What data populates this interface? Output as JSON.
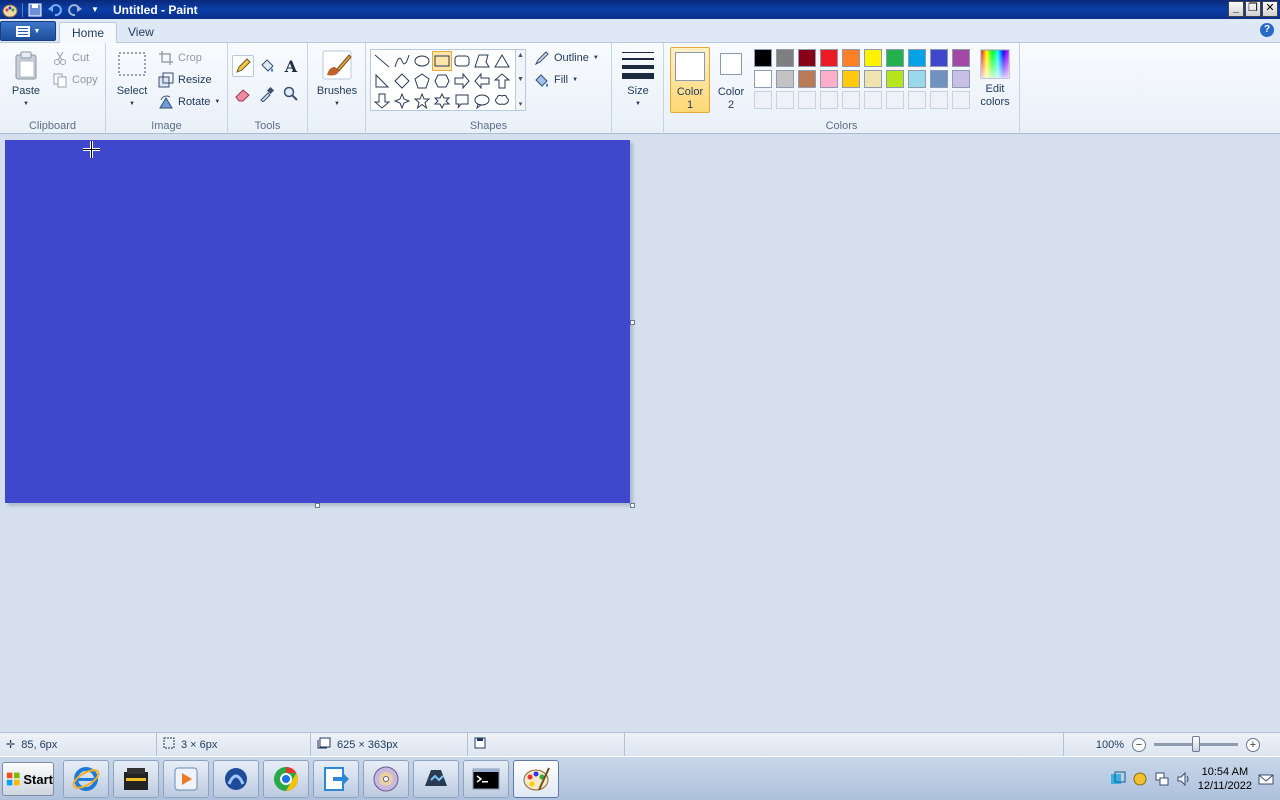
{
  "window": {
    "title": "Untitled - Paint"
  },
  "tabs": [
    {
      "label": "Home"
    },
    {
      "label": "View"
    }
  ],
  "ribbon": {
    "clipboard": {
      "label": "Clipboard",
      "paste": "Paste",
      "cut": "Cut",
      "copy": "Copy"
    },
    "image": {
      "label": "Image",
      "select": "Select",
      "crop": "Crop",
      "resize": "Resize",
      "rotate": "Rotate"
    },
    "tools": {
      "label": "Tools"
    },
    "brushes": {
      "label": "Brushes"
    },
    "shapes": {
      "label": "Shapes",
      "outline": "Outline",
      "fill": "Fill"
    },
    "size": {
      "label": "Size"
    },
    "colors": {
      "label": "Colors",
      "color1": "Color\n1",
      "color1_a": "Color",
      "color1_b": "1",
      "color2_a": "Color",
      "color2_b": "2",
      "edit_a": "Edit",
      "edit_b": "colors",
      "row1": [
        "#000000",
        "#7f7f7f",
        "#880015",
        "#ed1c24",
        "#ff7f27",
        "#fff200",
        "#22b14c",
        "#00a2e8",
        "#3f48cc",
        "#a349a4"
      ],
      "row2": [
        "#ffffff",
        "#c3c3c3",
        "#b97a57",
        "#ffaec9",
        "#ffc90e",
        "#efe4b0",
        "#b5e61d",
        "#99d9ea",
        "#7092be",
        "#c8bfe7"
      ]
    }
  },
  "canvas": {
    "color": "#3f48cc"
  },
  "status": {
    "position": "85, 6px",
    "selection": "3 × 6px",
    "canvas_size": "625 × 363px",
    "zoom": "100%"
  },
  "taskbar": {
    "start": "Start",
    "time": "10:54 AM",
    "date": "12/11/2022"
  }
}
